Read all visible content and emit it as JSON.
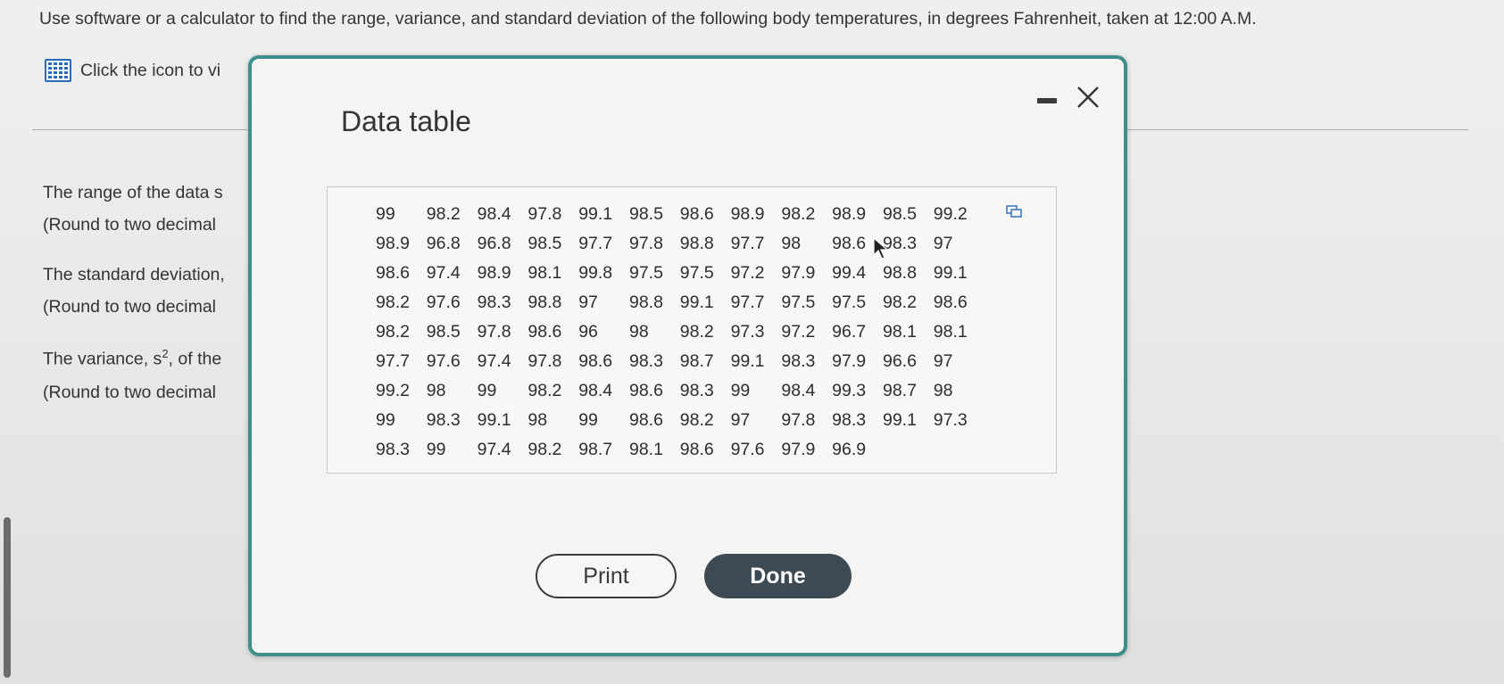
{
  "question": "Use software or a calculator to find the range, variance, and standard deviation of the following body temperatures, in degrees Fahrenheit, taken at 12:00 A.M.",
  "data_link_text": "Click the icon to vi",
  "answers": {
    "range_label": "The range of the data s",
    "range_round": "(Round to two decimal",
    "sd_label": "The standard deviation,",
    "sd_round": "(Round to two decimal",
    "variance_prefix": "The variance, s",
    "variance_sup": "2",
    "variance_suffix": ", of the",
    "variance_round": "(Round to two decimal"
  },
  "modal": {
    "title": "Data table",
    "print_label": "Print",
    "done_label": "Done",
    "rows": [
      [
        "99",
        "98.2",
        "98.4",
        "97.8",
        "99.1",
        "98.5",
        "98.6",
        "98.9",
        "98.2",
        "98.9",
        "98.5",
        "99.2"
      ],
      [
        "98.9",
        "96.8",
        "96.8",
        "98.5",
        "97.7",
        "97.8",
        "98.8",
        "97.7",
        "98",
        "98.6",
        "98.3",
        "97"
      ],
      [
        "98.6",
        "97.4",
        "98.9",
        "98.1",
        "99.8",
        "97.5",
        "97.5",
        "97.2",
        "97.9",
        "99.4",
        "98.8",
        "99.1"
      ],
      [
        "98.2",
        "97.6",
        "98.3",
        "98.8",
        "97",
        "98.8",
        "99.1",
        "97.7",
        "97.5",
        "97.5",
        "98.2",
        "98.6"
      ],
      [
        "98.2",
        "98.5",
        "97.8",
        "98.6",
        "96",
        "98",
        "98.2",
        "97.3",
        "97.2",
        "96.7",
        "98.1",
        "98.1"
      ],
      [
        "97.7",
        "97.6",
        "97.4",
        "97.8",
        "98.6",
        "98.3",
        "98.7",
        "99.1",
        "98.3",
        "97.9",
        "96.6",
        "97"
      ],
      [
        "99.2",
        "98",
        "99",
        "98.2",
        "98.4",
        "98.6",
        "98.3",
        "99",
        "98.4",
        "99.3",
        "98.7",
        "98"
      ],
      [
        "99",
        "98.3",
        "99.1",
        "98",
        "99",
        "98.6",
        "98.2",
        "97",
        "97.8",
        "98.3",
        "99.1",
        "97.3"
      ],
      [
        "98.3",
        "99",
        "97.4",
        "98.2",
        "98.7",
        "98.1",
        "98.6",
        "97.6",
        "97.9",
        "96.9"
      ]
    ]
  },
  "colors": {
    "modal_border": "#3e8f8a",
    "done_button": "#3e4a53",
    "icon_blue": "#2a6ab8"
  }
}
